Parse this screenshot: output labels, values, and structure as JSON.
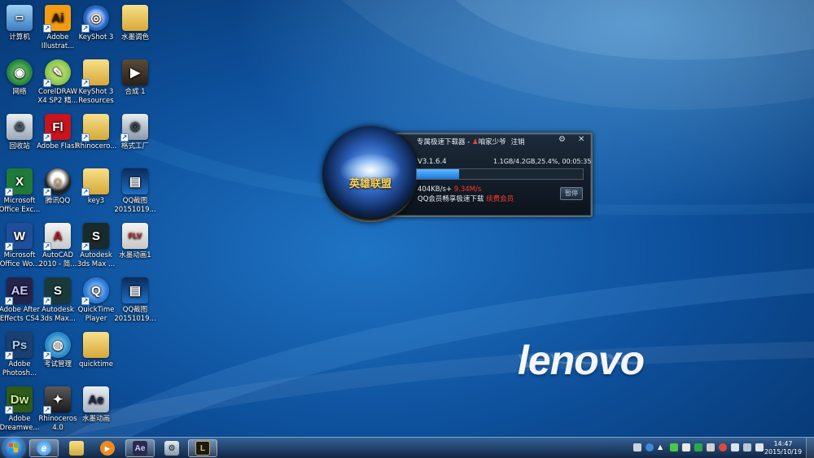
{
  "desktop": {
    "icons": [
      {
        "label": "计算机",
        "icon": "computer-icon"
      },
      {
        "label": "Adobe Illustrat...",
        "icon": "illustrator-icon"
      },
      {
        "label": "KeyShot 3",
        "icon": "keyshot-icon"
      },
      {
        "label": "水墨调色",
        "icon": "folder-icon"
      },
      {
        "label": "网络",
        "icon": "network-icon"
      },
      {
        "label": "CorelDRAW X4 SP2 精...",
        "icon": "coreldraw-icon"
      },
      {
        "label": "KeyShot 3 Resources",
        "icon": "folder-icon"
      },
      {
        "label": "合成 1",
        "icon": "video-icon"
      },
      {
        "label": "回收站",
        "icon": "recycle-bin-icon"
      },
      {
        "label": "Adobe Flash",
        "icon": "flash-icon"
      },
      {
        "label": "Rhinocero...",
        "icon": "folder-icon"
      },
      {
        "label": "格式工厂",
        "icon": "format-factory-icon"
      },
      {
        "label": "Microsoft Office Exc...",
        "icon": "excel-icon"
      },
      {
        "label": "腾讯QQ",
        "icon": "qq-icon"
      },
      {
        "label": "key3",
        "icon": "folder-icon"
      },
      {
        "label": "QQ截图 20151019...",
        "icon": "image-icon"
      },
      {
        "label": "Microsoft Office Wo...",
        "icon": "word-icon"
      },
      {
        "label": "AutoCAD 2010 - 简...",
        "icon": "autocad-icon"
      },
      {
        "label": "Autodesk 3ds Max ...",
        "icon": "3dsmax-icon"
      },
      {
        "label": "水墨动画1",
        "icon": "flv-icon"
      },
      {
        "label": "Adobe After Effects CS4",
        "icon": "after-effects-icon"
      },
      {
        "label": "Autodesk 3ds Max...",
        "icon": "3dsmax-design-icon"
      },
      {
        "label": "QuickTime Player",
        "icon": "quicktime-icon"
      },
      {
        "label": "QQ截图 20151019...",
        "icon": "image-icon"
      },
      {
        "label": "Adobe Photosh...",
        "icon": "photoshop-icon"
      },
      {
        "label": "考试管理",
        "icon": "globe-icon"
      },
      {
        "label": "quicktime",
        "icon": "folder-icon"
      },
      {
        "label": "Adobe Dreamwe...",
        "icon": "dreamweaver-icon"
      },
      {
        "label": "Rhinoceros 4.0",
        "icon": "rhinoceros-icon"
      },
      {
        "label": "水墨动画",
        "icon": "aep-file-icon"
      }
    ]
  },
  "downloader": {
    "title": "专属极速下载器 - ",
    "username": "咱家少爷",
    "logout_label": "注销",
    "game_title": "英雄联盟",
    "version": "V3.1.6.4",
    "stats": "1.1GB/4.2GB,25.4%,  00:05:35",
    "progress": 0.254,
    "speed": "404KB/s+ ",
    "speed_boost": "9.34M/s",
    "promo": "QQ会员畅享极速下载 ",
    "promo_link": "续费会员",
    "pause_label": "暂停",
    "settings_icon": "gear-icon",
    "close_icon": "close-icon"
  },
  "brand": {
    "logo_text": "lenovo"
  },
  "taskbar": {
    "pinned": [
      {
        "name": "ie",
        "glyph": "e",
        "color": "#2a8be0"
      },
      {
        "name": "explorer",
        "glyph": "",
        "color": "#e8c15a"
      },
      {
        "name": "media-player",
        "glyph": "▶",
        "color": "#f08a20"
      },
      {
        "name": "after-effects",
        "glyph": "Ae",
        "color": "#2a2a4a"
      },
      {
        "name": "format-factory",
        "glyph": "",
        "color": "#c8d0d8"
      },
      {
        "name": "league-of-legends",
        "glyph": "L",
        "color": "#1a1a12"
      }
    ],
    "time": "14:47",
    "date": "2015/10/19"
  },
  "colors": {
    "accent_red": "#ff3a2a",
    "progress_blue": "#1d78d8"
  }
}
